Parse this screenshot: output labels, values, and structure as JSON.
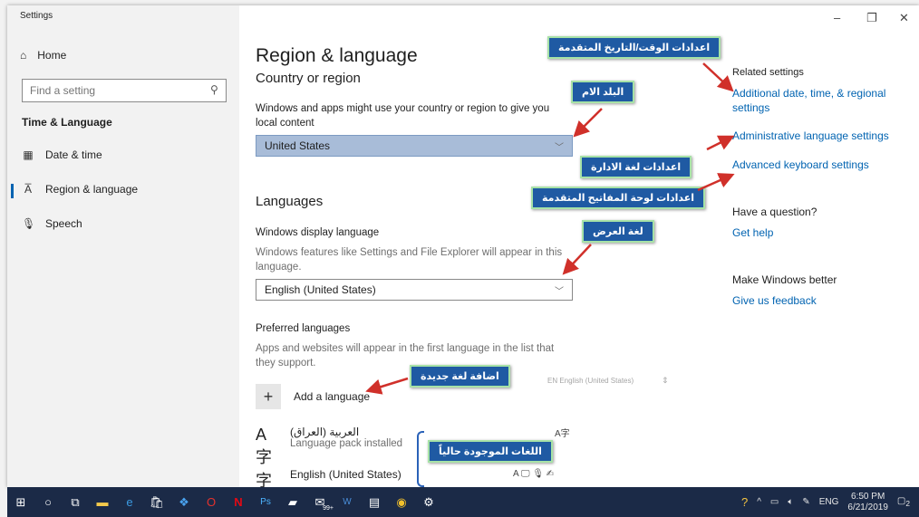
{
  "window": {
    "title": "Settings",
    "controls": [
      "–",
      "❐",
      "✕"
    ]
  },
  "sidebar": {
    "home": "Home",
    "search_placeholder": "Find a setting",
    "section": "Time & Language",
    "items": [
      {
        "label": "Date & time",
        "icon": "calendar-clock-icon"
      },
      {
        "label": "Region & language",
        "icon": "language-icon",
        "selected": true
      },
      {
        "label": "Speech",
        "icon": "microphone-icon"
      }
    ]
  },
  "main": {
    "title": "Region & language",
    "country_heading": "Country or region",
    "country_desc": "Windows and apps might use your country or region to give you local content",
    "country_value": "United States",
    "languages_heading": "Languages",
    "display_lang_label": "Windows display language",
    "display_lang_desc": "Windows features like Settings and File Explorer will appear in this language.",
    "display_lang_value": "English (United States)",
    "preferred_label": "Preferred languages",
    "preferred_desc": "Apps and websites will appear in the first language in the list that they support.",
    "add_language": "Add a language",
    "ghost_lang": "EN English (United States)",
    "languages": [
      {
        "name": "العربية (العراق)",
        "sub": "Language pack installed"
      },
      {
        "name": "English (United States)",
        "sub": ""
      }
    ]
  },
  "right": {
    "related_heading": "Related settings",
    "links": [
      "Additional date, time, & regional settings",
      "Administrative language settings",
      "Advanced keyboard settings"
    ],
    "question_heading": "Have a question?",
    "get_help": "Get help",
    "better_heading": "Make Windows better",
    "feedback": "Give us feedback"
  },
  "annotations": {
    "date_time": "اعدادات الوقت/التاريخ المتقدمة",
    "home_country": "البلد الام",
    "admin_lang": "اعدادات لغة الادارة",
    "adv_keyboard": "اعدادات لوحة المفاتيح المتقدمة",
    "display_lang": "لغة العرض",
    "add_lang": "اضافة لغة جديدة",
    "current_langs": "اللغات الموجودة حالياً"
  },
  "taskbar": {
    "badge": "99+",
    "tray_lang": "ENG",
    "time": "6:50 PM",
    "date": "6/21/2019",
    "notif_count": "2"
  },
  "colors": {
    "accent": "#0063b1",
    "annotation": "#1f5aa3",
    "annotation_border": "#a7e2a7",
    "arrow": "#d0302a",
    "taskbar": "#1b2a47"
  }
}
